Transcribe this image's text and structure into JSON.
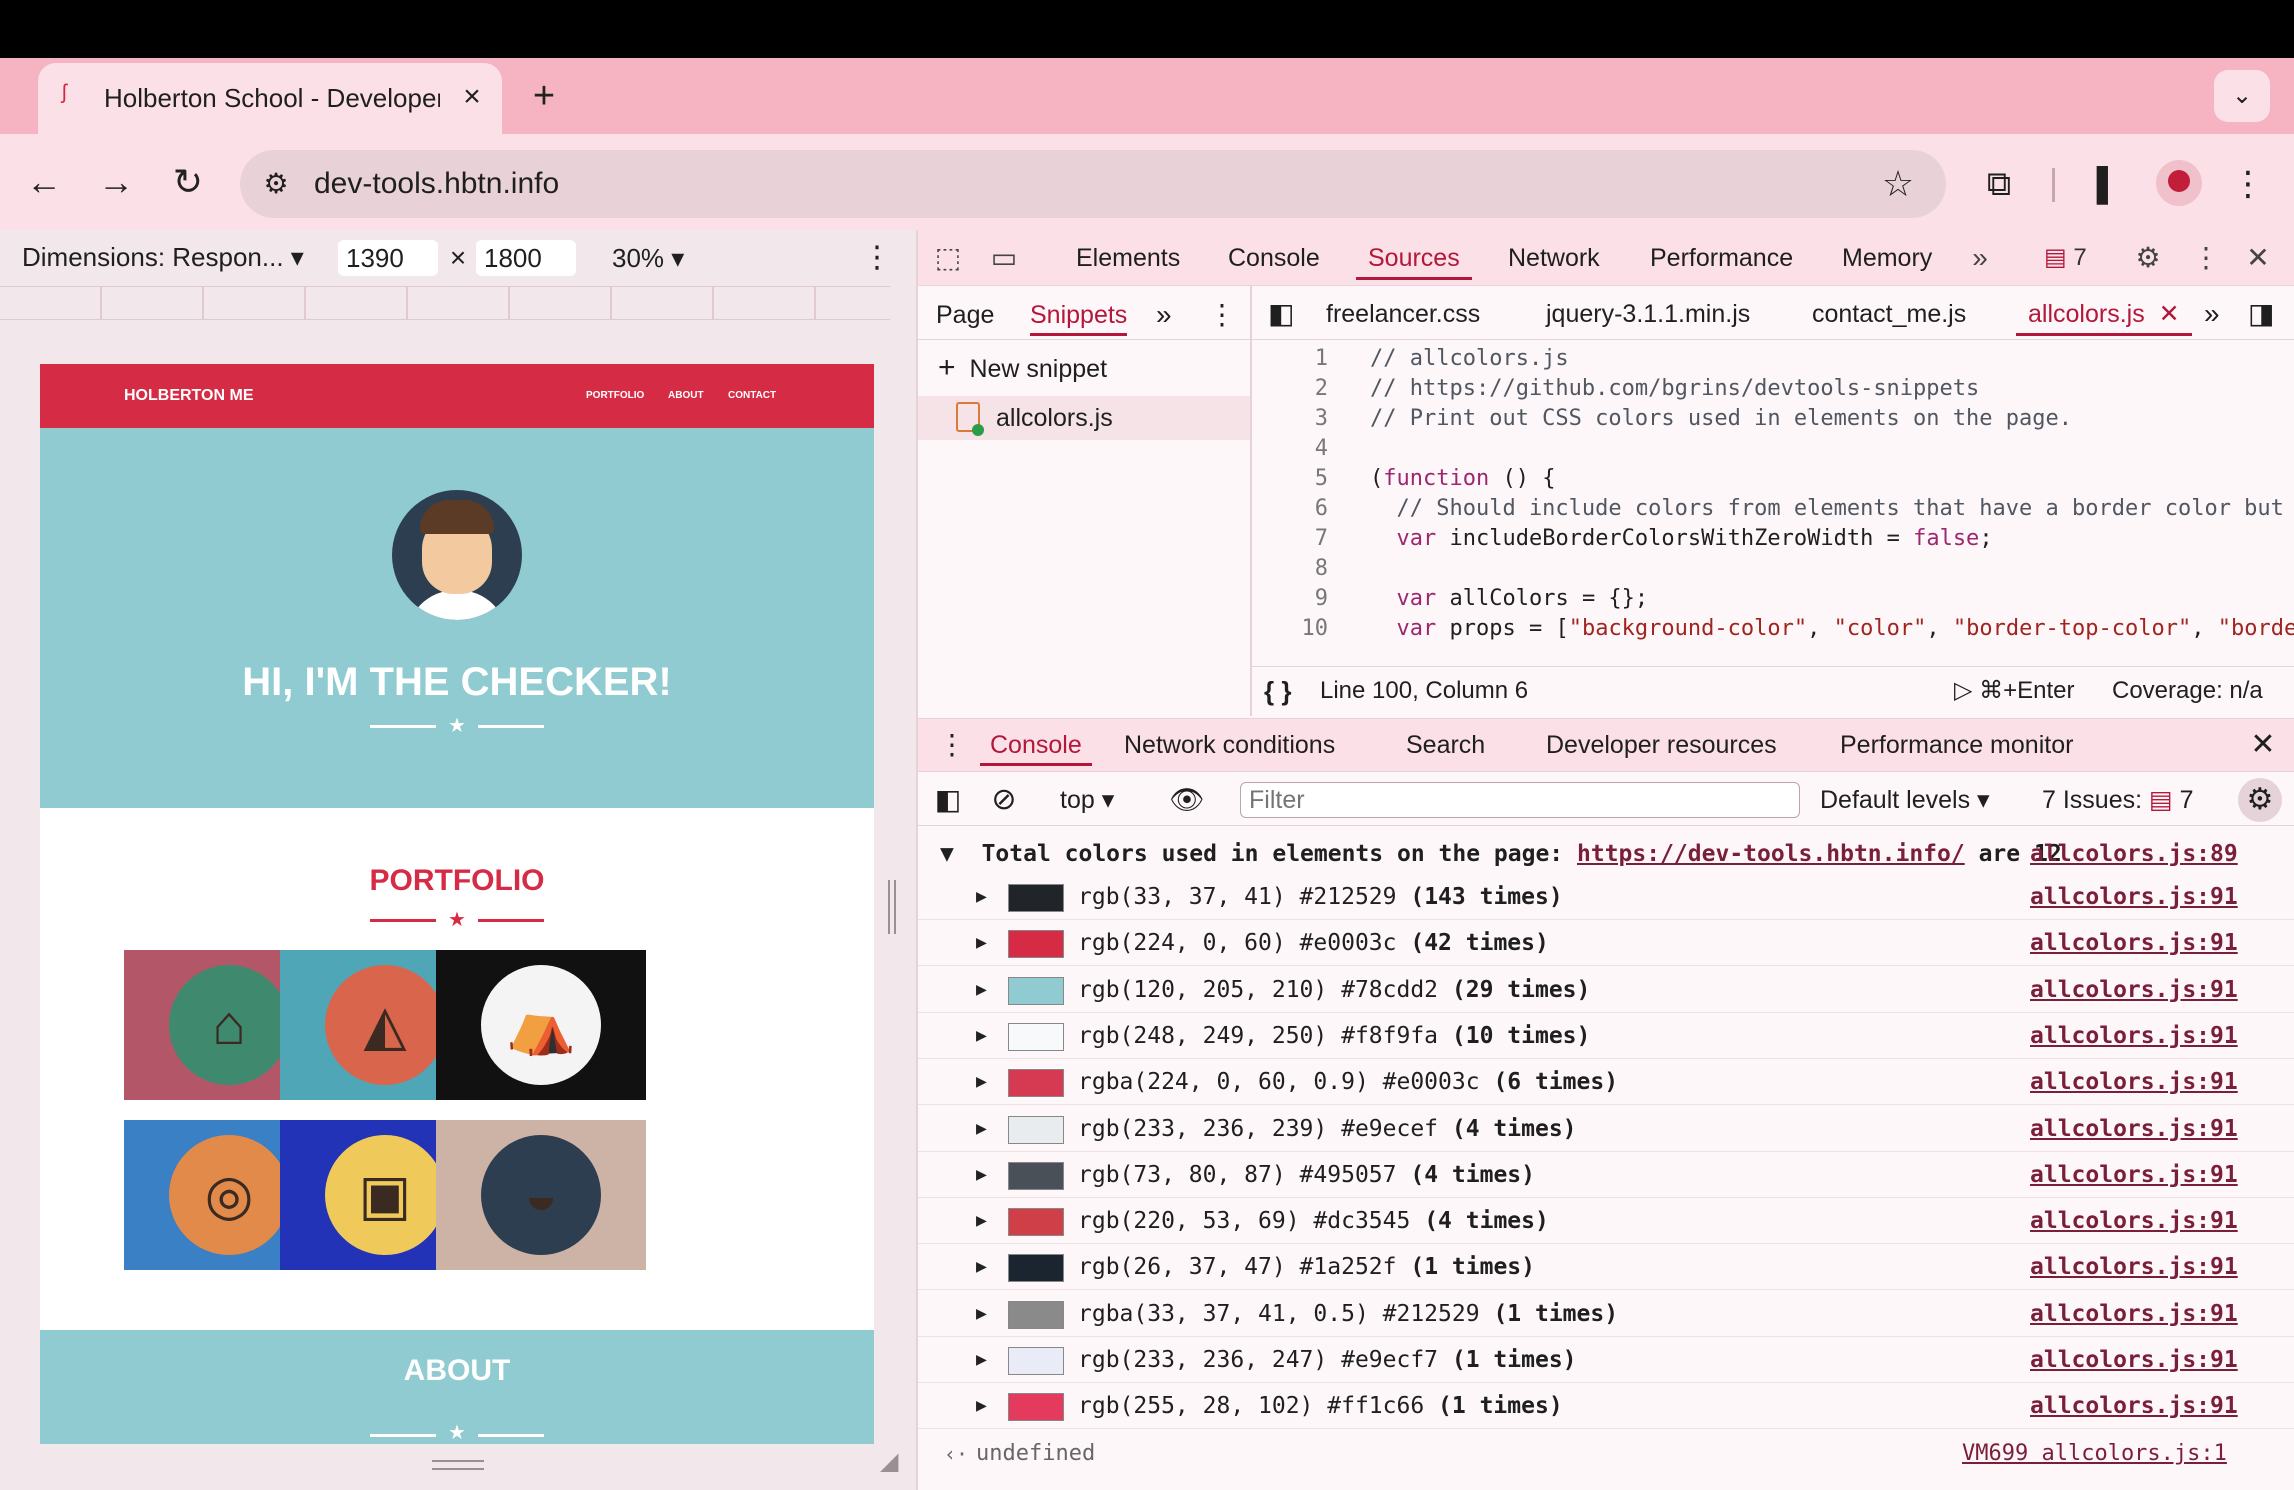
{
  "browser": {
    "tab_title": "Holberton School - Developer",
    "url": "dev-tools.hbtn.info",
    "icons": [
      "back-icon",
      "forward-icon",
      "reload-icon",
      "site-settings-icon",
      "star-icon",
      "extensions-icon",
      "side-panel-icon",
      "profile-icon",
      "menu-icon"
    ]
  },
  "device_toolbar": {
    "dimensions_label": "Dimensions: Respon...",
    "width": "1390",
    "times": "×",
    "height": "1800",
    "zoom": "30%"
  },
  "site": {
    "brand": "HOLBERTON ME",
    "nav": [
      "PORTFOLIO",
      "ABOUT",
      "CONTACT"
    ],
    "hero_title": "HI, I'M THE CHECKER!",
    "portfolio_title": "PORTFOLIO",
    "about_title": "ABOUT",
    "colors": {
      "primary": "#d62b45",
      "teal": "#8fcbd1"
    },
    "tiles": [
      {
        "bg": "#b35768",
        "circle": "#3f8a6e",
        "icon": "cabin-icon"
      },
      {
        "bg": "#4fa6b6",
        "circle": "#d9654c",
        "icon": "cake-icon"
      },
      {
        "bg": "#111111",
        "circle": "#f4f4f4",
        "icon": "circus-tent-icon"
      },
      {
        "bg": "#3a80c4",
        "circle": "#e28a4a",
        "icon": "game-controller-icon"
      },
      {
        "bg": "#2233b8",
        "circle": "#efc95a",
        "icon": "safe-icon"
      },
      {
        "bg": "#cdb3a6",
        "circle": "#2d3e50",
        "icon": "submarine-icon"
      }
    ]
  },
  "devtools": {
    "tabs": [
      "Elements",
      "Console",
      "Sources",
      "Network",
      "Performance",
      "Memory"
    ],
    "active_tab": "Sources",
    "issues_count": "7",
    "sources_nav_tabs": [
      "Page",
      "Snippets"
    ],
    "new_snippet": "New snippet",
    "snippet_file": "allcolors.js",
    "editor_tabs": [
      "freelancer.css",
      "jquery-3.1.1.min.js",
      "contact_me.js",
      "allcolors.js"
    ],
    "code_lines": [
      "// allcolors.js",
      "// https://github.com/bgrins/devtools-snippets",
      "// Print out CSS colors used in elements on the page.",
      "",
      "(function () {",
      "  // Should include colors from elements that have a border color but",
      "  var includeBorderColorsWithZeroWidth = false;",
      "",
      "  var allColors = {};",
      "  var props = [\"background-color\", \"color\", \"border-top-color\", \"borde"
    ],
    "status": {
      "position": "Line 100, Column 6",
      "run": "⌘+Enter",
      "coverage": "Coverage: n/a"
    },
    "drawer_tabs": [
      "Console",
      "Network conditions",
      "Search",
      "Developer resources",
      "Performance monitor"
    ],
    "console_toolbar": {
      "context": "top",
      "filter_placeholder": "Filter",
      "levels": "Default levels",
      "issues_label": "7 Issues:",
      "issues_count": "7"
    },
    "console": {
      "header_prefix": "Total colors used in elements on the page: ",
      "header_link": "https://dev-tools.hbtn.info/",
      "header_suffix": " are 12",
      "header_source": "allcolors.js:89",
      "rows": [
        {
          "color": "rgb(33, 37, 41) #212529",
          "count": "(143 times)",
          "swatch": "#212529",
          "source": "allcolors.js:91"
        },
        {
          "color": "rgb(224, 0, 60) #e0003c",
          "count": "(42 times)",
          "swatch": "#d62b45",
          "source": "allcolors.js:91"
        },
        {
          "color": "rgb(120, 205, 210) #78cdd2",
          "count": "(29 times)",
          "swatch": "#8fcbd1",
          "source": "allcolors.js:91"
        },
        {
          "color": "rgb(248, 249, 250) #f8f9fa",
          "count": "(10 times)",
          "swatch": "#f8f9fa",
          "source": "allcolors.js:91"
        },
        {
          "color": "rgba(224, 0, 60, 0.9) #e0003c",
          "count": "(6 times)",
          "swatch": "#d63a52",
          "source": "allcolors.js:91"
        },
        {
          "color": "rgb(233, 236, 239) #e9ecef",
          "count": "(4 times)",
          "swatch": "#e9ecef",
          "source": "allcolors.js:91"
        },
        {
          "color": "rgb(73, 80, 87) #495057",
          "count": "(4 times)",
          "swatch": "#495057",
          "source": "allcolors.js:91"
        },
        {
          "color": "rgb(220, 53, 69) #dc3545",
          "count": "(4 times)",
          "swatch": "#cf3f48",
          "source": "allcolors.js:91"
        },
        {
          "color": "rgb(26, 37, 47) #1a252f",
          "count": "(1 times)",
          "swatch": "#1a252f",
          "source": "allcolors.js:91"
        },
        {
          "color": "rgba(33, 37, 41, 0.5) #212529",
          "count": "(1 times)",
          "swatch": "#8a8a8a",
          "source": "allcolors.js:91"
        },
        {
          "color": "rgb(233, 236, 247) #e9ecf7",
          "count": "(1 times)",
          "swatch": "#e9ecf7",
          "source": "allcolors.js:91"
        },
        {
          "color": "rgb(255, 28, 102) #ff1c66",
          "count": "(1 times)",
          "swatch": "#e33a5e",
          "source": "allcolors.js:91"
        }
      ],
      "result": "undefined",
      "result_source": "VM699 allcolors.js:1"
    }
  }
}
